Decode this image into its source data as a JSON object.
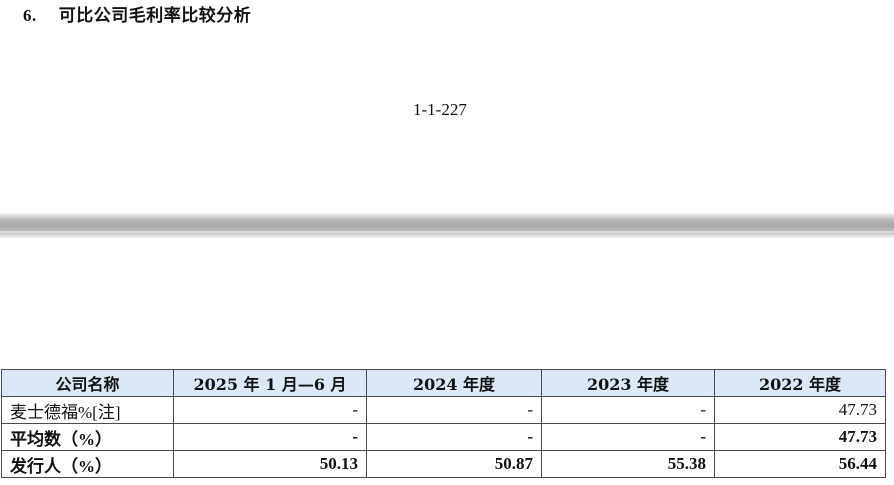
{
  "section": {
    "number": "6.",
    "title": "可比公司毛利率比较分析"
  },
  "page_number": "1-1-227",
  "table": {
    "headers": [
      "公司名称",
      "2025 年 1 月—6 月",
      "2024 年度",
      "2023 年度",
      "2022 年度"
    ],
    "rows": [
      {
        "name": "麦士德福%[注]",
        "values": [
          "-",
          "-",
          "-",
          "47.73"
        ]
      },
      {
        "name": "平均数（%）",
        "values": [
          "-",
          "-",
          "-",
          "47.73"
        ]
      },
      {
        "name": "发行人（%）",
        "values": [
          "50.13",
          "50.87",
          "55.38",
          "56.44"
        ]
      }
    ]
  }
}
